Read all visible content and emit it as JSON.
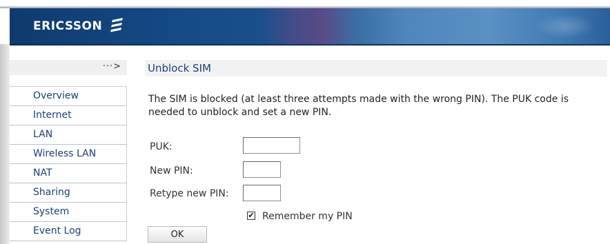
{
  "header": {
    "brand": "ERICSSON",
    "colors": {
      "banner_dark": "#103a6e",
      "banner_light": "#5b90c4",
      "link": "#1b3f74"
    },
    "logo_icon": "ericsson-stripes-icon"
  },
  "breadcrumb_arrow": "···>",
  "page_title": "Unblock SIM",
  "sidebar": {
    "items": [
      {
        "label": "Overview"
      },
      {
        "label": "Internet"
      },
      {
        "label": "LAN"
      },
      {
        "label": "Wireless LAN"
      },
      {
        "label": "NAT"
      },
      {
        "label": "Sharing"
      },
      {
        "label": "System"
      },
      {
        "label": "Event Log"
      }
    ]
  },
  "intro_text": "The SIM is blocked (at least three attempts made with the wrong PIN). The PUK code is needed to unblock and set a new PIN.",
  "form": {
    "puk_label": "PUK:",
    "puk_value": "",
    "new_pin_label": "New PIN:",
    "new_pin_value": "",
    "retype_pin_label": "Retype new PIN:",
    "retype_pin_value": "",
    "remember_label": "Remember my PIN",
    "remember_checked": true,
    "remember_mark": "✔",
    "ok_label": "OK"
  }
}
